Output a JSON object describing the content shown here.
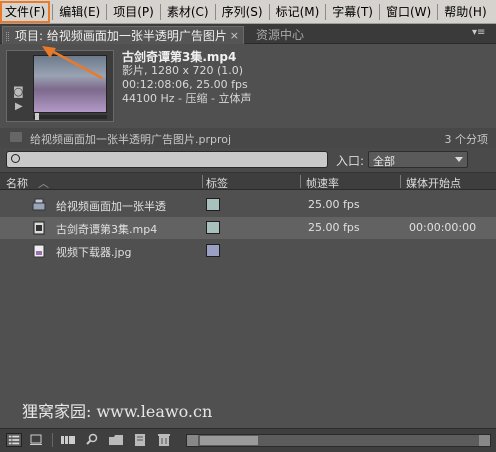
{
  "menu": {
    "items": [
      "文件(F)",
      "编辑(E)",
      "项目(P)",
      "素材(C)",
      "序列(S)",
      "标记(M)",
      "字幕(T)",
      "窗口(W)",
      "帮助(H)"
    ]
  },
  "tabs": {
    "active_label": "项目: 给视频画面加一张半透明广告图片",
    "close_glyph": "×",
    "inactive_label": "资源中心",
    "panel_menu_glyph": "▾≡"
  },
  "preview": {
    "file_name": "古剑奇谭第3集.mp4",
    "line2": "影片, 1280 x 720 (1.0)",
    "line3": "00:12:08:06, 25.00 fps",
    "line4": "44100 Hz - 压缩 - 立体声"
  },
  "project": {
    "file": "给视频画面加一张半透明广告图片.prproj",
    "count": "3 个分项"
  },
  "search": {
    "value": "",
    "placeholder": "",
    "in_label": "入口:",
    "in_selected": "全部"
  },
  "table": {
    "headers": {
      "name": "名称",
      "label": "标签",
      "fps": "帧速率",
      "start": "媒体开始点"
    },
    "rows": [
      {
        "name": "给视频画面加一张半透",
        "label_color": "#a9c1bd",
        "fps": "25.00 fps",
        "start": "",
        "icon": "sequence-icon"
      },
      {
        "name": "古剑奇谭第3集.mp4",
        "label_color": "#a9c1bd",
        "fps": "25.00 fps",
        "start": "00:00:00:00",
        "icon": "movie-clip-icon"
      },
      {
        "name": "视频下载器.jpg",
        "label_color": "#9aa0c4",
        "fps": "",
        "start": "",
        "icon": "image-file-icon"
      }
    ]
  },
  "watermark": "狸窝家园: www.leawo.cn",
  "colors": {
    "highlight": "#e87a2a",
    "panel_bg": "#505050"
  }
}
